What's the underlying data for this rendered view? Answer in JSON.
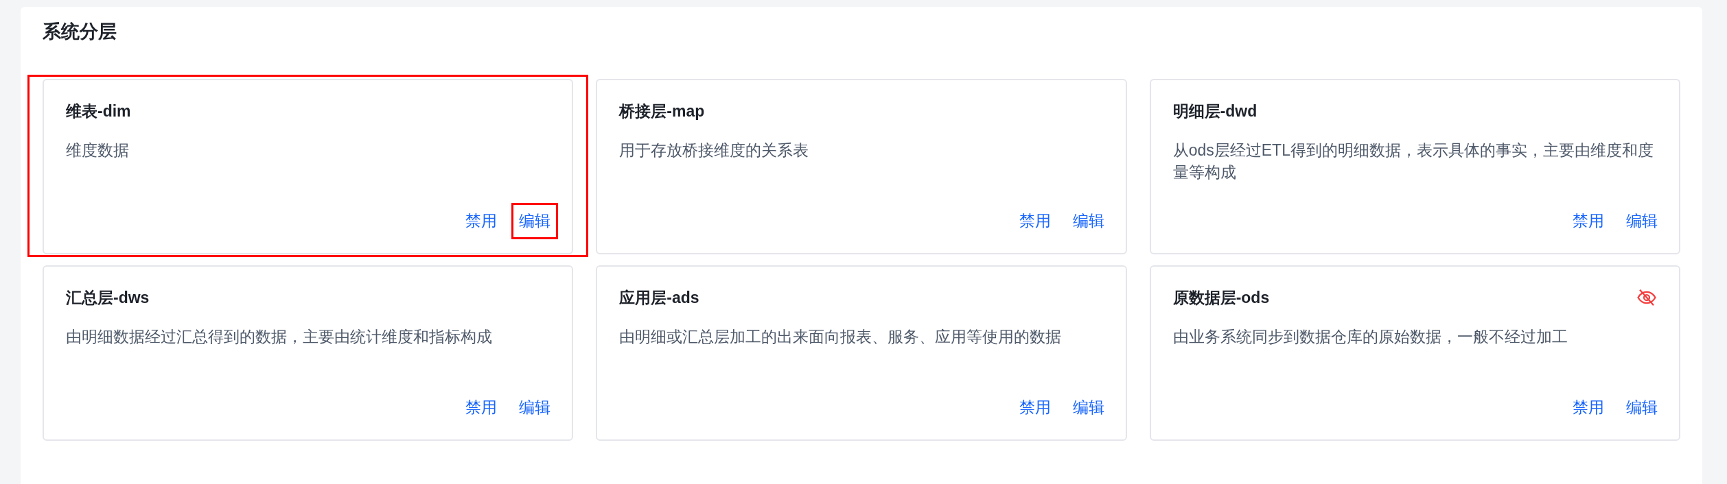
{
  "panel": {
    "title": "系统分层"
  },
  "layers": [
    {
      "name": "维表-dim",
      "description": "维度数据",
      "hidden": false,
      "highlighted": true,
      "actions": [
        {
          "label": "禁用",
          "highlighted": false
        },
        {
          "label": "编辑",
          "highlighted": true
        }
      ]
    },
    {
      "name": "桥接层-map",
      "description": "用于存放桥接维度的关系表",
      "hidden": false,
      "highlighted": false,
      "actions": [
        {
          "label": "禁用",
          "highlighted": false
        },
        {
          "label": "编辑",
          "highlighted": false
        }
      ]
    },
    {
      "name": "明细层-dwd",
      "description": "从ods层经过ETL得到的明细数据，表示具体的事实，主要由维度和度量等构成",
      "hidden": false,
      "highlighted": false,
      "actions": [
        {
          "label": "禁用",
          "highlighted": false
        },
        {
          "label": "编辑",
          "highlighted": false
        }
      ]
    },
    {
      "name": "汇总层-dws",
      "description": "由明细数据经过汇总得到的数据，主要由统计维度和指标构成",
      "hidden": false,
      "highlighted": false,
      "actions": [
        {
          "label": "禁用",
          "highlighted": false
        },
        {
          "label": "编辑",
          "highlighted": false
        }
      ]
    },
    {
      "name": "应用层-ads",
      "description": "由明细或汇总层加工的出来面向报表、服务、应用等使用的数据",
      "hidden": false,
      "highlighted": false,
      "actions": [
        {
          "label": "禁用",
          "highlighted": false
        },
        {
          "label": "编辑",
          "highlighted": false
        }
      ]
    },
    {
      "name": "原数据层-ods",
      "description": "由业务系统同步到数据仓库的原始数据，一般不经过加工",
      "hidden": true,
      "highlighted": false,
      "actions": [
        {
          "label": "禁用",
          "highlighted": false
        },
        {
          "label": "编辑",
          "highlighted": false
        }
      ]
    }
  ]
}
